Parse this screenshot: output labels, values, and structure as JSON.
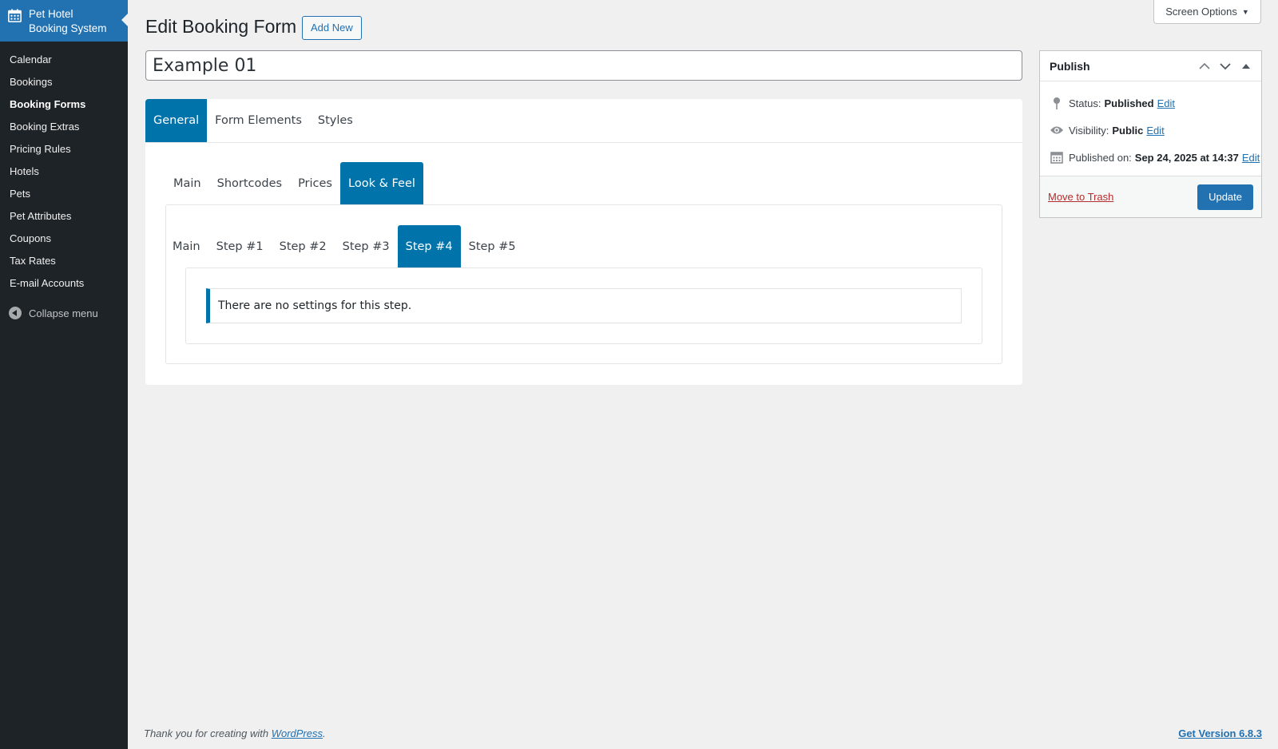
{
  "brand": {
    "title_line1": "Pet Hotel",
    "title_line2": "Booking System",
    "icon": "calendar-icon"
  },
  "sidebar": {
    "items": [
      {
        "label": "Calendar"
      },
      {
        "label": "Bookings"
      },
      {
        "label": "Booking Forms",
        "active": true
      },
      {
        "label": "Booking Extras"
      },
      {
        "label": "Pricing Rules"
      },
      {
        "label": "Hotels"
      },
      {
        "label": "Pets"
      },
      {
        "label": "Pet Attributes"
      },
      {
        "label": "Coupons"
      },
      {
        "label": "Tax Rates"
      },
      {
        "label": "E-mail Accounts"
      }
    ],
    "collapse_label": "Collapse menu"
  },
  "screen_options": {
    "label": "Screen Options"
  },
  "header": {
    "title": "Edit Booking Form",
    "add_new": "Add New"
  },
  "form": {
    "title_value": "Example 01"
  },
  "tabs_level1": [
    "General",
    "Form Elements",
    "Styles"
  ],
  "tabs_level2": [
    "Main",
    "Shortcodes",
    "Prices",
    "Look & Feel"
  ],
  "tabs_level3": [
    "Main",
    "Step #1",
    "Step #2",
    "Step #3",
    "Step #4",
    "Step #5"
  ],
  "notice": {
    "text": "There are no settings for this step."
  },
  "publish": {
    "title": "Publish",
    "status_label": "Status:",
    "status_value": "Published",
    "visibility_label": "Visibility:",
    "visibility_value": "Public",
    "published_label": "Published on:",
    "published_value": "Sep 24, 2025 at 14:37",
    "edit": "Edit",
    "trash": "Move to Trash",
    "update": "Update"
  },
  "footer": {
    "thanks_prefix": "Thank you for creating with",
    "thanks_link": "WordPress",
    "thanks_suffix": ".",
    "version": "Get Version 6.8.3"
  },
  "colors": {
    "accent": "#0073aa",
    "admin_blue": "#2271b1",
    "sidebar_bg": "#1d2327",
    "trash_red": "#b32d2e"
  }
}
